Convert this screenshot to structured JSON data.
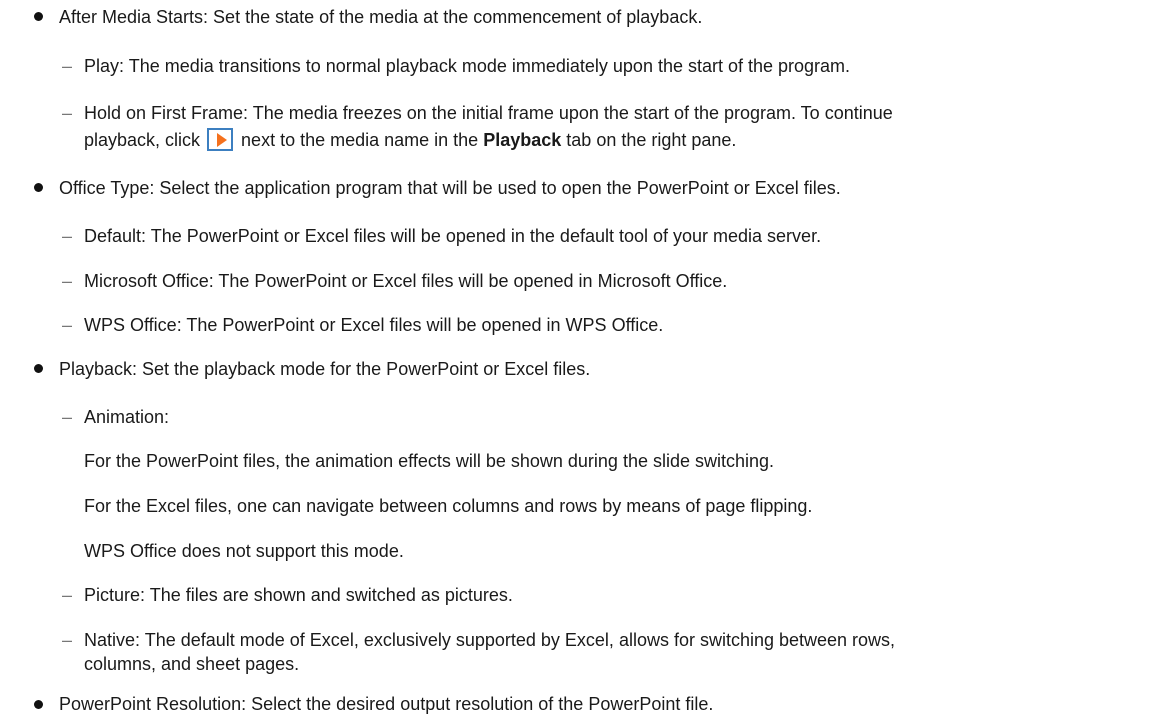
{
  "items": {
    "after_media": {
      "text": "After Media Starts: Set the state of the media at the commencement of playback.",
      "play": "Play: The media transitions to normal playback mode immediately upon the start of the program.",
      "hold_line1": "Hold on First Frame: The media freezes on the initial frame upon the start of the program. To continue",
      "hold_line2_a": "playback, click",
      "hold_line2_b": "next to the media name in the",
      "hold_line2_bold": "Playback",
      "hold_line2_c": "tab on the right pane."
    },
    "office_type": {
      "text": "Office Type: Select the application program that will be used to open the PowerPoint or Excel files.",
      "default": "Default: The PowerPoint or Excel files will be opened in the default tool of your media server.",
      "microsoft": "Microsoft Office: The PowerPoint or Excel files will be opened in Microsoft Office.",
      "wps": "WPS Office: The PowerPoint or Excel files will be opened in WPS Office."
    },
    "playback": {
      "text": "Playback: Set the playback mode for the PowerPoint or Excel files.",
      "animation": "Animation:",
      "animation_p1": "For the PowerPoint files, the animation effects will be shown during the slide switching.",
      "animation_p2": "For the Excel files, one can navigate between columns and rows by means of page flipping.",
      "animation_p3": "WPS Office does not support this mode.",
      "picture": "Picture: The files are shown and switched as pictures.",
      "native_line1": "Native: The default mode of Excel, exclusively supported by Excel, allows for switching between rows,",
      "native_line2": "columns, and sheet pages."
    },
    "resolution": {
      "text": "PowerPoint Resolution: Select the desired output resolution of the PowerPoint file."
    }
  },
  "symbols": {
    "dash": "–"
  },
  "icons": {
    "play_icon": "play-icon"
  },
  "colors": {
    "text": "#1a1a1a",
    "icon_border": "#3c7fc0",
    "icon_triangle": "#f5711d"
  }
}
